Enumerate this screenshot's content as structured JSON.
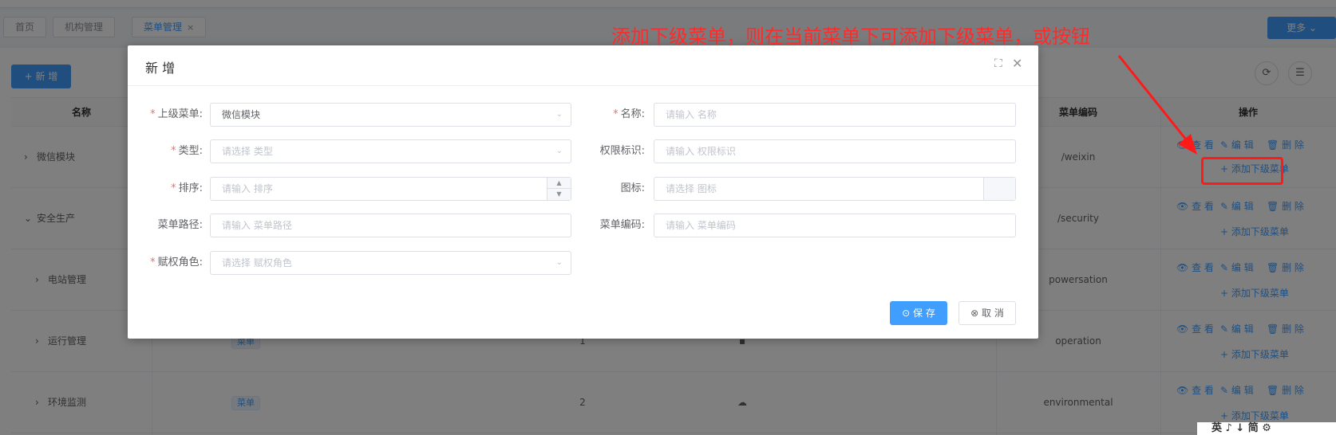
{
  "tags": [
    {
      "label": "首页"
    },
    {
      "label": "机构管理"
    },
    {
      "label": "菜单管理",
      "close": "×"
    }
  ],
  "more_label": "更多 ⌄",
  "add_label": "+ 新 增",
  "table": {
    "headers": {
      "name": "名称",
      "code": "菜单编码",
      "ops": "操作"
    },
    "rows": [
      {
        "name": "微信模块",
        "expand": "›",
        "code": "/weixin",
        "view": "查 看",
        "edit": "编 辑",
        "del": "删 除",
        "sub": "添加下级菜单"
      },
      {
        "name": "安全生产",
        "expand": "⌄",
        "code": "/security",
        "view": "查 看",
        "edit": "编 辑",
        "del": "删 除",
        "sub": "添加下级菜单"
      },
      {
        "name": "电站管理",
        "expand": "›",
        "code": "powersation",
        "view": "查 看",
        "edit": "编 辑",
        "del": "删 除",
        "sub": "添加下级菜单"
      },
      {
        "name": "运行管理",
        "expand": "›",
        "code": "operation",
        "type": "菜单",
        "sort": "1",
        "view": "查 看",
        "edit": "编 辑",
        "del": "删 除",
        "sub": "添加下级菜单"
      },
      {
        "name": "环境监测",
        "expand": "›",
        "code": "environmental",
        "type": "菜单",
        "sort": "2",
        "view": "查 看",
        "edit": "编 辑",
        "del": "删 除",
        "sub": "添加下级菜单"
      }
    ]
  },
  "modal": {
    "title": "新 增",
    "fields": {
      "parent": {
        "label": "上级菜单:",
        "value": "微信模块"
      },
      "name": {
        "label": "名称:",
        "placeholder": "请输入 名称"
      },
      "type": {
        "label": "类型:",
        "placeholder": "请选择 类型"
      },
      "perm": {
        "label": "权限标识:",
        "placeholder": "请输入 权限标识"
      },
      "sort": {
        "label": "排序:",
        "placeholder": "请输入 排序"
      },
      "icon": {
        "label": "图标:",
        "placeholder": "请选择 图标"
      },
      "path": {
        "label": "菜单路径:",
        "placeholder": "请输入 菜单路径"
      },
      "code": {
        "label": "菜单编码:",
        "placeholder": "请输入 菜单编码"
      },
      "role": {
        "label": "赋权角色:",
        "placeholder": "请选择 赋权角色"
      }
    },
    "save_label": "保 存",
    "cancel_label": "取 消"
  },
  "annotation": "添加下级菜单，则在当前菜单下可添加下级菜单，或按钮",
  "corner_text": "英 ♪ ↓ 简 ⚙",
  "colors": {
    "primary": "#409eff",
    "annotation": "#ff1a1a",
    "required": "#f56c6c"
  }
}
